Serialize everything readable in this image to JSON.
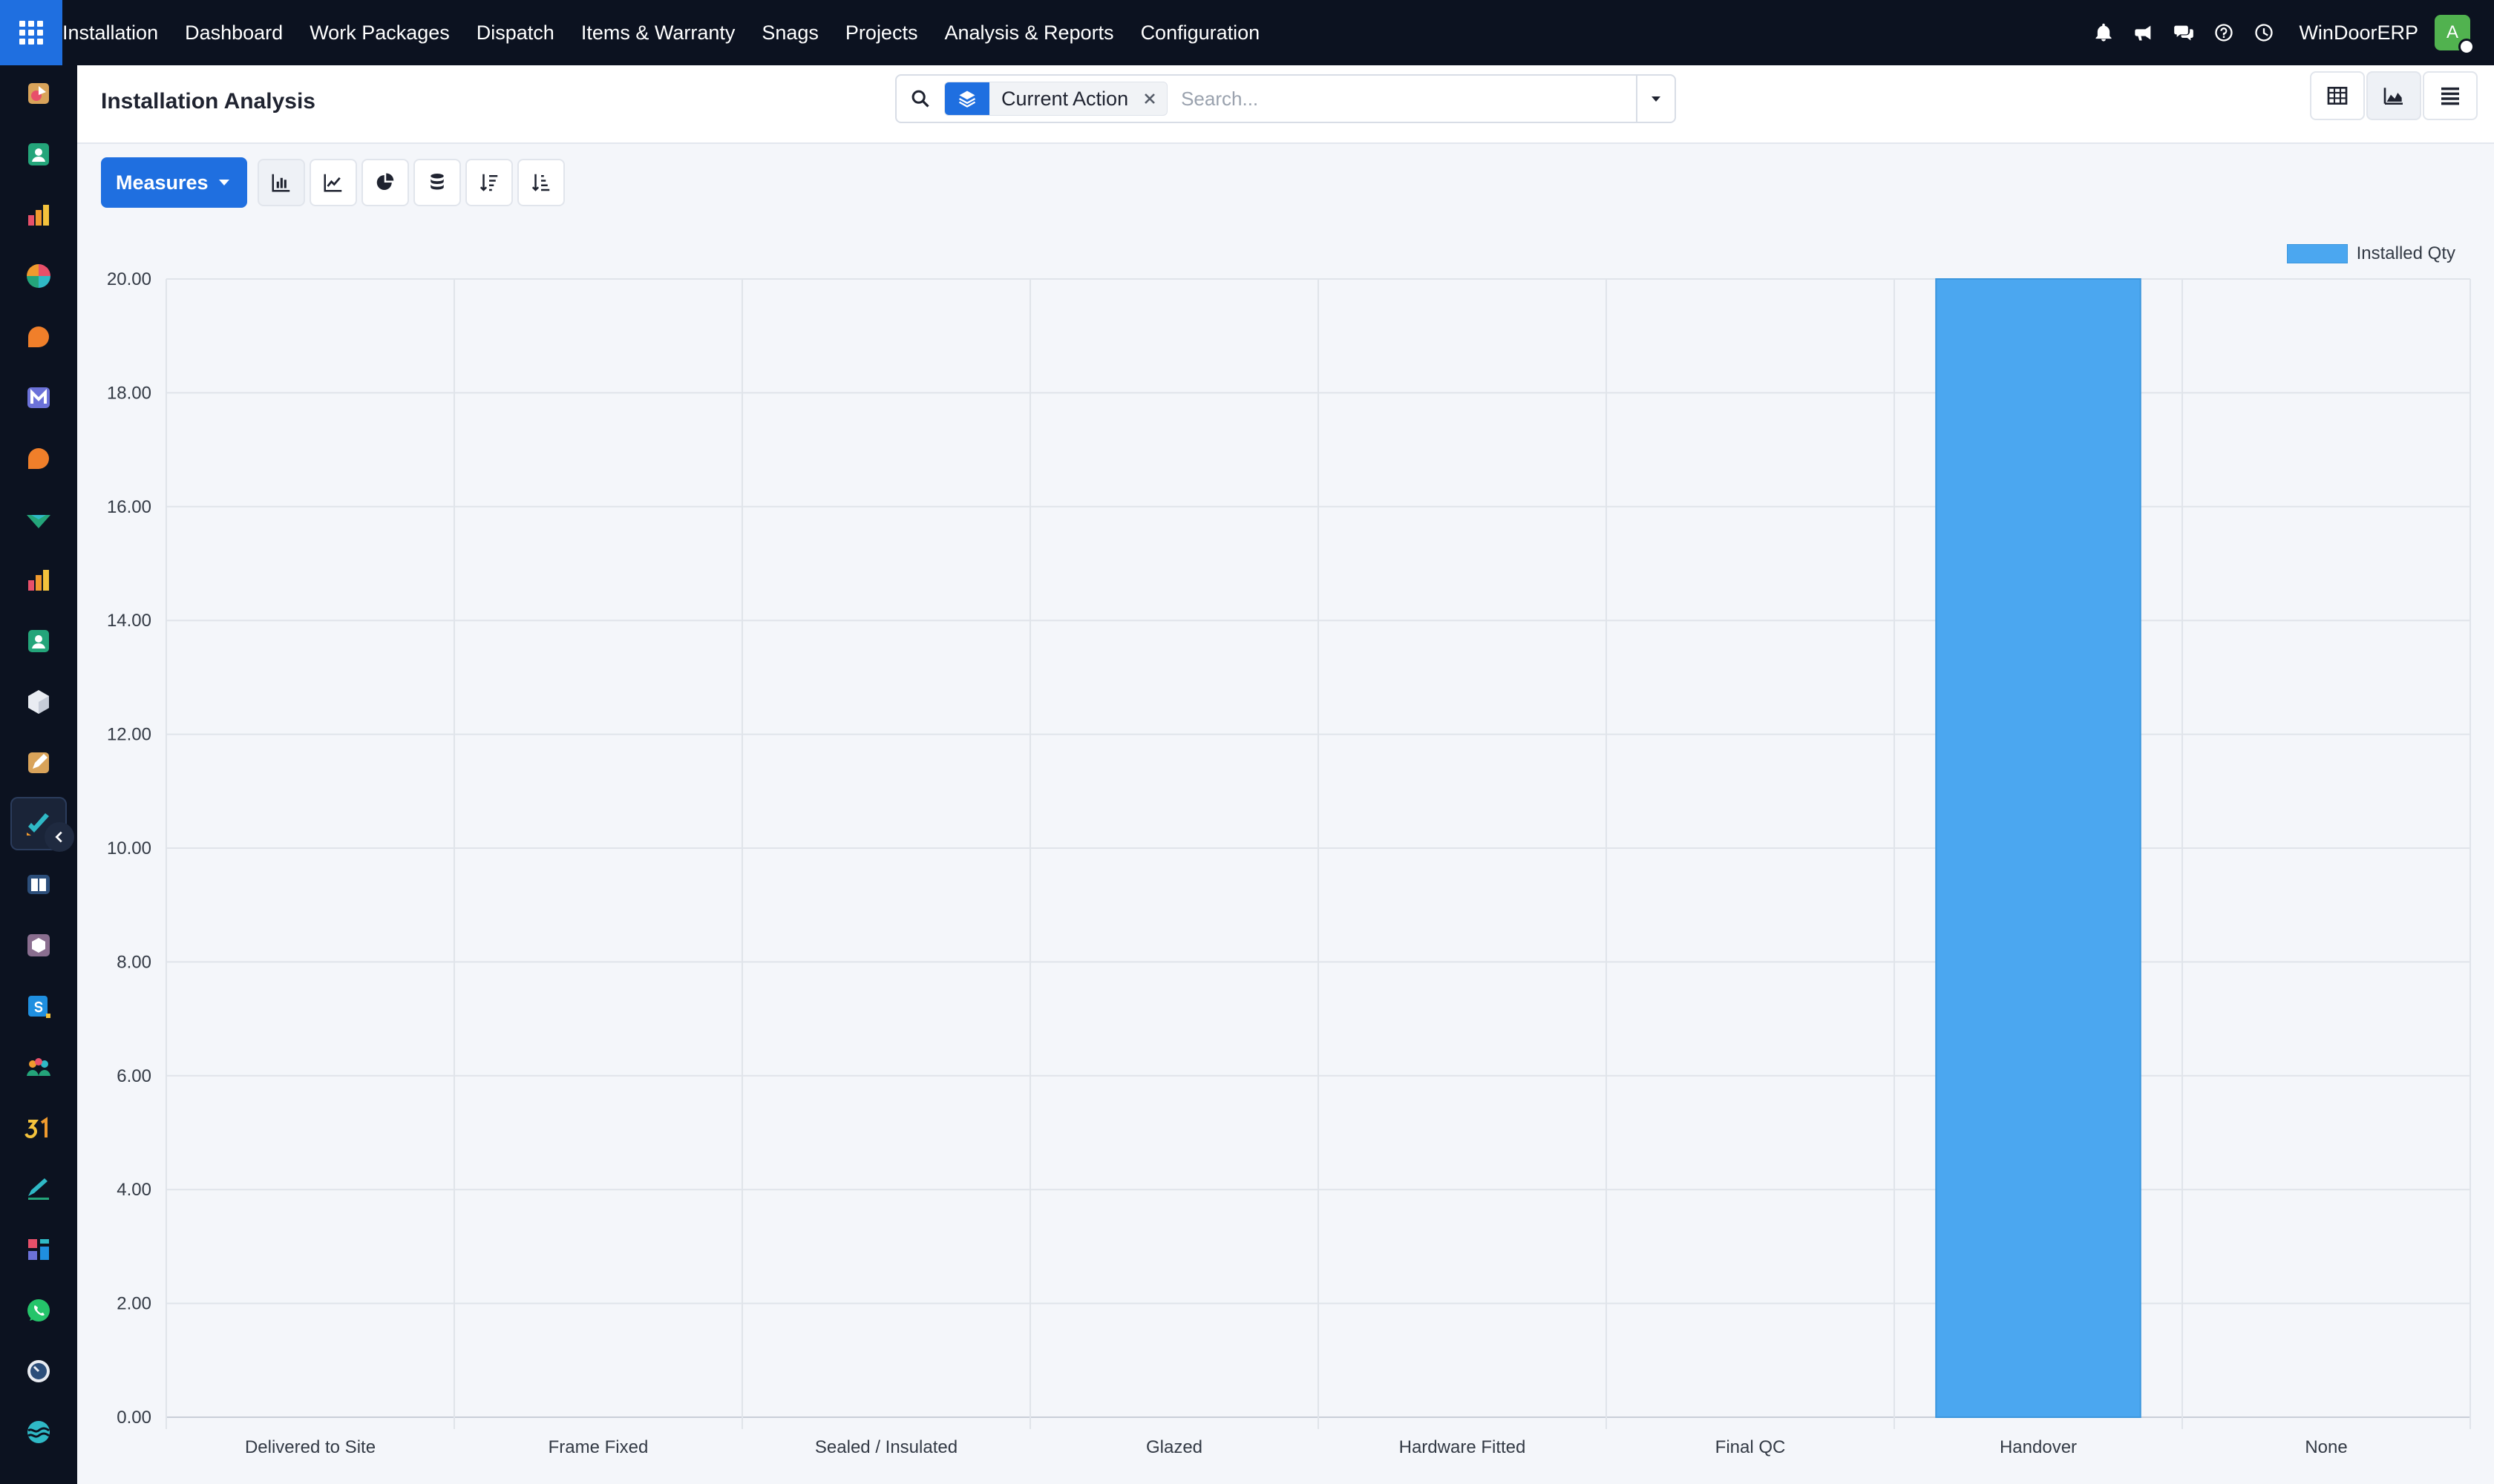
{
  "topbar": {
    "app_name": "Installation",
    "menu": [
      "Dashboard",
      "Work Packages",
      "Dispatch",
      "Items & Warranty",
      "Snags",
      "Projects",
      "Analysis & Reports",
      "Configuration"
    ],
    "company": "WinDoorERP",
    "avatar_initial": "A",
    "icons": [
      "bell-icon",
      "megaphone-icon",
      "chat-icon",
      "help-icon",
      "clock-icon"
    ]
  },
  "sidebar": {
    "items": [
      "app-icon-1",
      "app-icon-contacts",
      "app-icon-chart",
      "app-icon-pie",
      "app-icon-discuss",
      "app-icon-mail",
      "app-icon-chat",
      "app-icon-check",
      "app-icon-reports",
      "app-icon-id",
      "app-icon-cube",
      "app-icon-edit",
      "app-icon-installation",
      "app-icon-knowledge",
      "app-icon-box",
      "app-icon-sales",
      "app-icon-team",
      "app-icon-calendar",
      "app-icon-sign",
      "app-icon-dashboard",
      "app-icon-whatsapp",
      "app-icon-timer",
      "app-icon-wave"
    ],
    "active_index": 12
  },
  "control_panel": {
    "title": "Installation Analysis",
    "facet_label": "Current Action",
    "search_placeholder": "Search..."
  },
  "toolbar": {
    "measures_label": "Measures"
  },
  "colors": {
    "bar": "#4ba7f0",
    "accent": "#1f6fe0",
    "navbar": "#0c1220"
  },
  "chart_data": {
    "type": "bar",
    "categories": [
      "Delivered to Site",
      "Frame Fixed",
      "Sealed / Insulated",
      "Glazed",
      "Hardware Fitted",
      "Final QC",
      "Handover",
      "None"
    ],
    "series": [
      {
        "name": "Installed Qty",
        "values": [
          0,
          0,
          0,
          0,
          0,
          0,
          20,
          0
        ]
      }
    ],
    "ylim": [
      0,
      20
    ],
    "yticks": [
      "0.00",
      "2.00",
      "4.00",
      "6.00",
      "8.00",
      "10.00",
      "12.00",
      "14.00",
      "16.00",
      "18.00",
      "20.00"
    ],
    "grid": true,
    "legend_position": "top-right"
  }
}
